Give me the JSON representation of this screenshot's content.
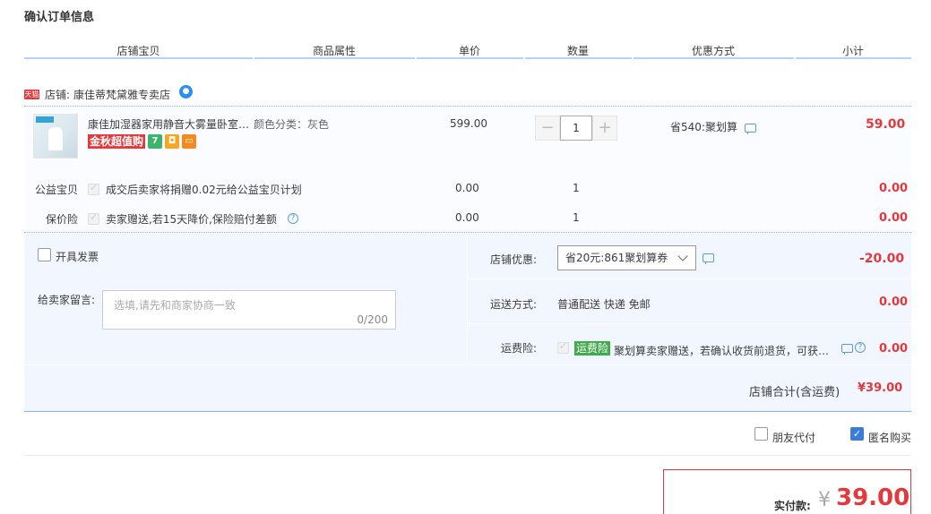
{
  "page_title": "确认订单信息",
  "columns": [
    "店铺宝贝",
    "商品属性",
    "单价",
    "数量",
    "优惠方式",
    "小计"
  ],
  "shop": {
    "tag": "天猫",
    "label": "店铺:",
    "name": "康佳蒂梵黛雅专卖店"
  },
  "item": {
    "name": "康佳加湿器家用静音大雾量卧室…",
    "property": "颜色分类：灰色",
    "badge": "金秋超值购",
    "unit_price": "599.00",
    "quantity": "1",
    "minus": "−",
    "plus": "+",
    "discount": "省540:聚划算",
    "subtotal": "59.00"
  },
  "charity": {
    "label": "公益宝贝",
    "text": "成交后卖家将捐赠0.02元给公益宝贝计划",
    "price": "0.00",
    "qty": "1",
    "subtotal": "0.00"
  },
  "insurance": {
    "label": "保价险",
    "text": "卖家赠送,若15天降价,保险赔付差额",
    "price": "0.00",
    "qty": "1",
    "subtotal": "0.00"
  },
  "invoice": {
    "label": "开具发票"
  },
  "message": {
    "label": "给卖家留言:",
    "placeholder": "选填,请先和商家协商一致",
    "counter": "0/200"
  },
  "store_discount": {
    "label": "店铺优惠:",
    "value": "省20元:861聚划算券",
    "amount": "-20.00"
  },
  "shipping": {
    "label": "运送方式:",
    "value": "普通配送 快递 免邮",
    "amount": "0.00"
  },
  "return_ins": {
    "label": "运费险:",
    "tag": "运费险",
    "text": "聚划算卖家赠送，若确认收货前退货，可获…",
    "amount": "0.00"
  },
  "store_total": {
    "label": "店铺合计(含运费)",
    "amount": "¥39.00"
  },
  "friend_pay": {
    "label": "朋友代付"
  },
  "anonymous": {
    "label": "匿名购买"
  },
  "payment": {
    "label": "实付款:",
    "currency": "¥",
    "amount": "39.00"
  }
}
